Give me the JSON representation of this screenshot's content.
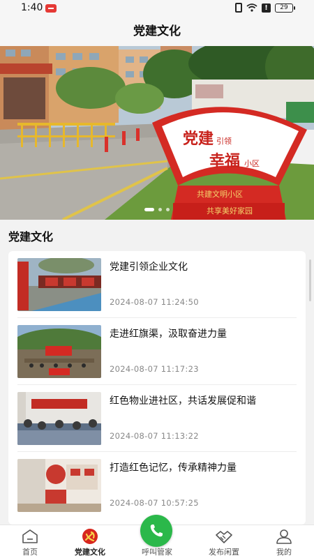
{
  "status_bar": {
    "time": "1:40",
    "battery": "29"
  },
  "header": {
    "title": "党建文化"
  },
  "banner": {
    "sign_line1": "党建",
    "sign_small": "引领",
    "sign_line2": "幸福",
    "sign_small2": "小区",
    "base_line1": "共建文明小区",
    "base_line2": "共享美好家园",
    "slide_count": 3,
    "active_slide": 1
  },
  "section": {
    "title": "党建文化"
  },
  "articles": [
    {
      "title": "党建引领企业文化",
      "time": "2024-08-07 11:24:50",
      "thumb": "party-corridor"
    },
    {
      "title": "走进红旗渠，汲取奋进力量",
      "time": "2024-08-07 11:17:23",
      "thumb": "mountain-flag"
    },
    {
      "title": "红色物业进社区，共话发展促和谐",
      "time": "2024-08-07 11:13:22",
      "thumb": "meeting-room"
    },
    {
      "title": "打造红色记忆，传承精神力量",
      "time": "2024-08-07 10:57:25",
      "thumb": "exhibition-room"
    }
  ],
  "nav": [
    {
      "label": "首页",
      "icon": "home-icon"
    },
    {
      "label": "党建文化",
      "icon": "party-emblem-icon"
    },
    {
      "label": "呼叫管家",
      "icon": "phone-icon"
    },
    {
      "label": "发布闲置",
      "icon": "handshake-icon"
    },
    {
      "label": "我的",
      "icon": "user-icon"
    }
  ],
  "colors": {
    "party_red": "#d7261e",
    "call_green": "#2bb84a",
    "background": "#f2f2f2"
  }
}
